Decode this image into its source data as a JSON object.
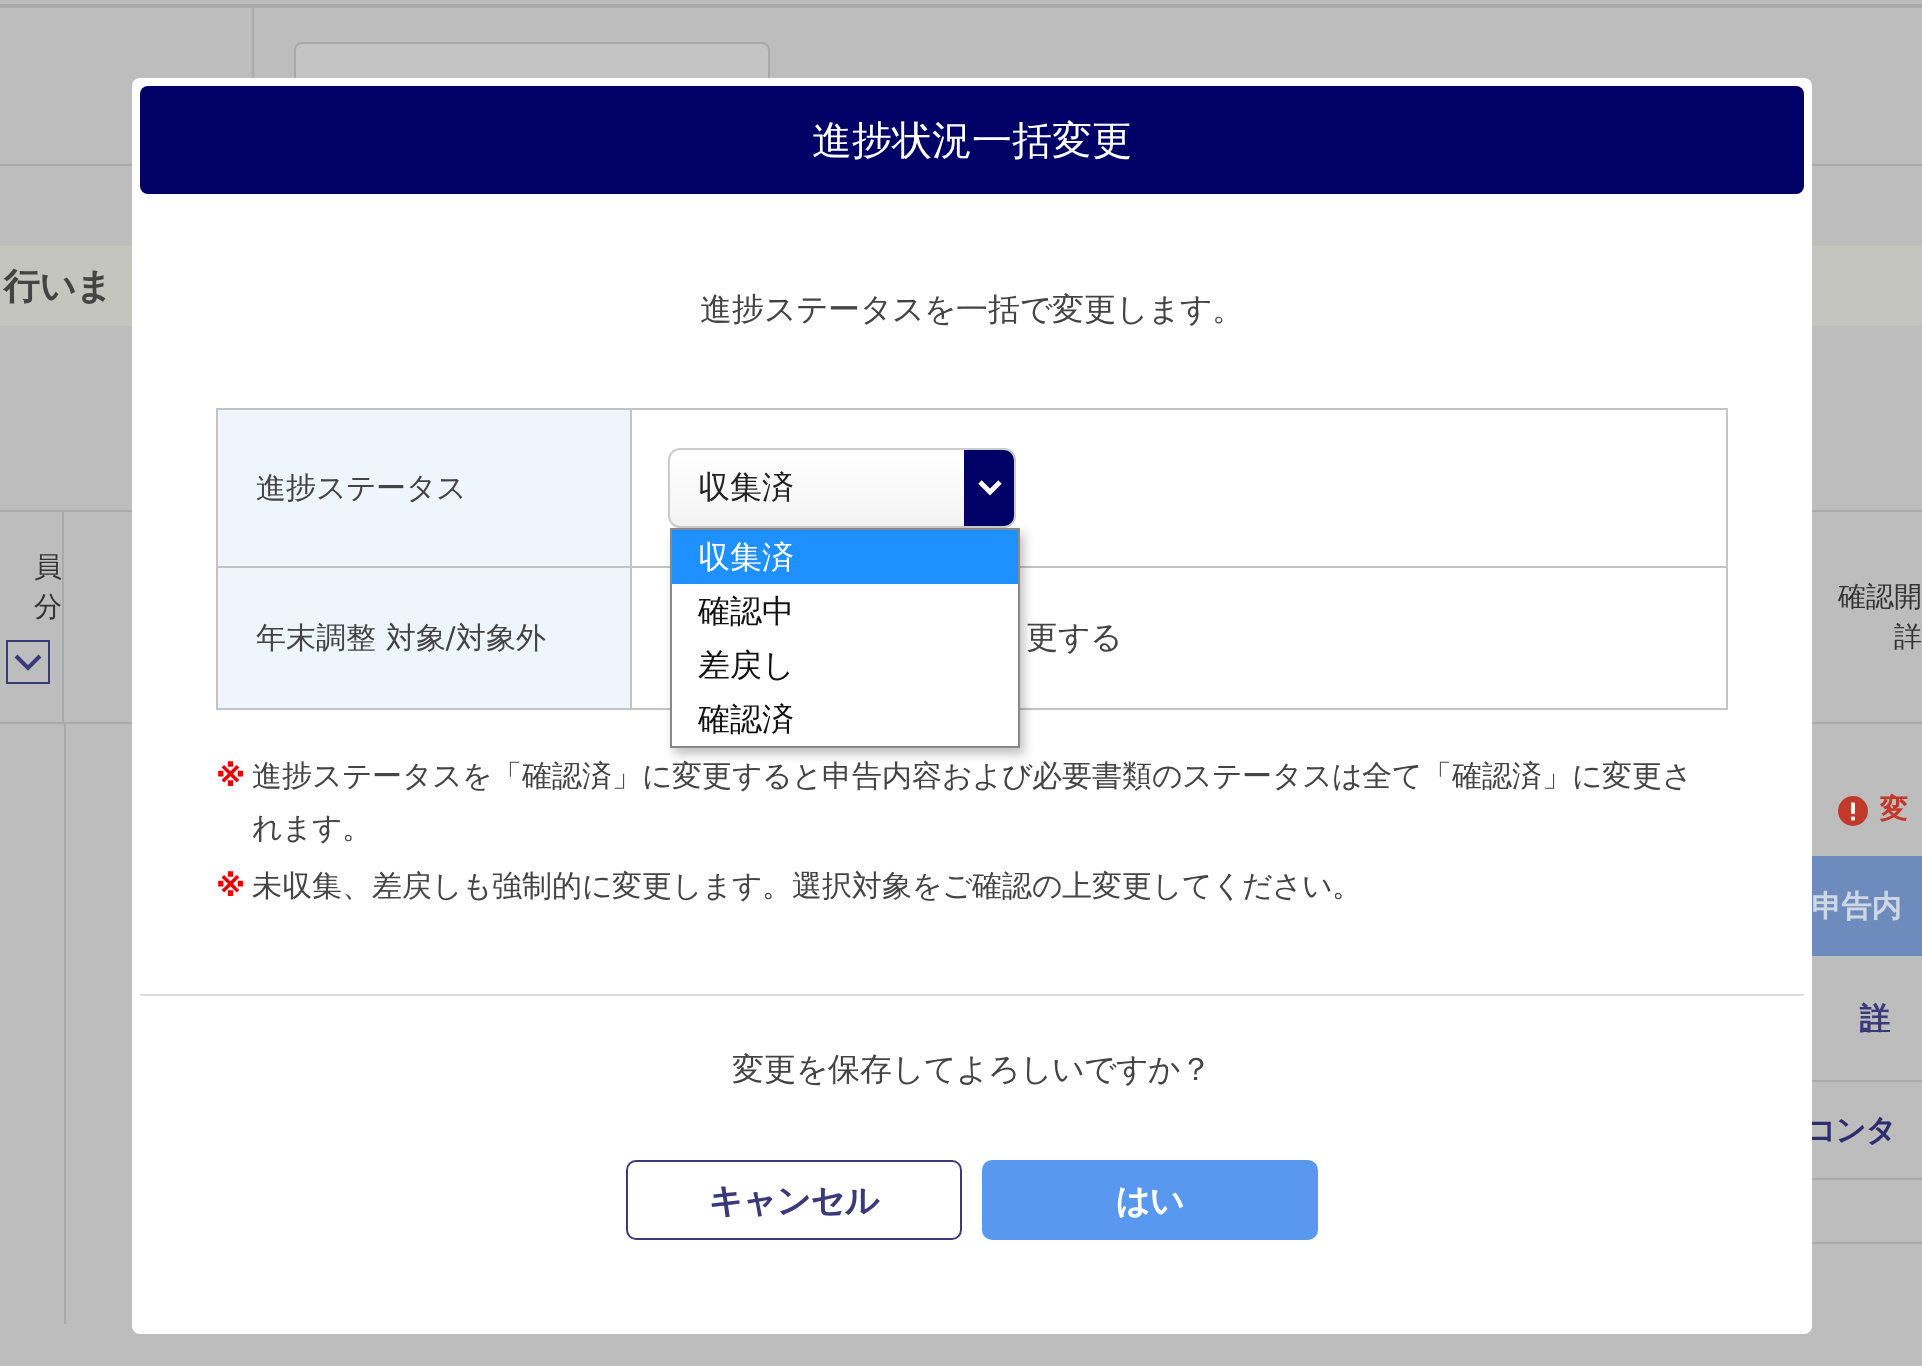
{
  "background": {
    "banner_text": "行いま",
    "header_left": [
      "員",
      "分"
    ],
    "header_right": [
      "確認開",
      "詳"
    ],
    "alert_text": "変",
    "tag_text": "申告内",
    "detail_link": "詳",
    "contact_text": "コンタ"
  },
  "dialog": {
    "title": "進捗状況一括変更",
    "lead": "進捗ステータスを一括で変更します。",
    "form_rows": [
      {
        "kind": "select",
        "label": "進捗ステータス",
        "value": "収集済",
        "expanded": true,
        "options": [
          {
            "label": "収集済",
            "selected": true
          },
          {
            "label": "確認中",
            "selected": false
          },
          {
            "label": "差戻し",
            "selected": false
          },
          {
            "label": "確認済",
            "selected": false
          }
        ]
      },
      {
        "kind": "text",
        "label": "年末調整 対象/対象外",
        "value": "更する"
      }
    ],
    "notes": [
      {
        "mark": "※",
        "text": "進捗ステータスを「確認済」に変更すると申告内容および必要書類のステータスは全て「確認済」に変更されます。"
      },
      {
        "mark": "※",
        "text": "未収集、差戻しも強制的に変更します。選択対象をご確認の上変更してください。"
      }
    ],
    "question": "変更を保存してよろしいですか？",
    "buttons": [
      {
        "kind": "secondary",
        "label": "キャンセル"
      },
      {
        "kind": "primary",
        "label": "はい"
      }
    ]
  }
}
